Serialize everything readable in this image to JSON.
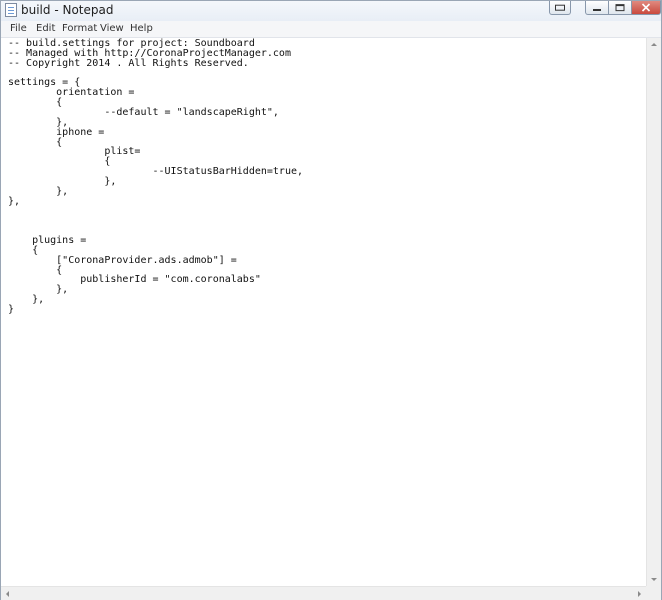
{
  "window": {
    "title": "build - Notepad"
  },
  "menu": [
    "File",
    "Edit",
    "Format",
    "View",
    "Help"
  ],
  "editor": {
    "lines": [
      "-- build.settings for project: Soundboard",
      "-- Managed with http://CoronaProjectManager.com",
      "-- Copyright 2014 . All Rights Reserved.",
      "",
      "settings = {",
      "        orientation =",
      "        {",
      "                --default = \"landscapeRight\",",
      "        },",
      "        iphone =",
      "        {",
      "                plist=",
      "                {",
      "                        --UIStatusBarHidden=true,",
      "                },",
      "        },",
      "},",
      "",
      "",
      "",
      "    plugins =",
      "    {",
      "        [\"CoronaProvider.ads.admob\"] =",
      "        {",
      "            publisherId = \"com.coronalabs\"",
      "        },",
      "    },",
      "}"
    ]
  },
  "icons": {
    "app": "notepad-icon",
    "snap": "snap-icon",
    "minimize": "minimize-icon",
    "maximize": "maximize-icon",
    "close": "close-icon"
  },
  "colors": {
    "close_button": "#c94a3e",
    "text": "#111111"
  }
}
